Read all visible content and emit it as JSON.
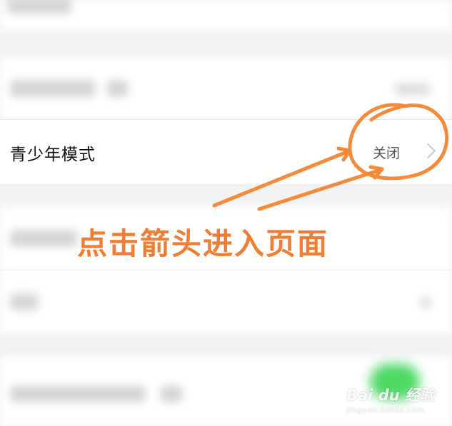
{
  "settings": {
    "teen_mode_row": {
      "label": "青少年模式",
      "value": "关闭"
    }
  },
  "annotation": {
    "text": "点击箭头进入页面",
    "color": "#f07d33"
  },
  "watermark": {
    "brand": "Bai du 经验",
    "url": "jingyan.baidu.com"
  },
  "colors": {
    "toggle_on": "#4cd964",
    "background": "#f2f2f4"
  }
}
